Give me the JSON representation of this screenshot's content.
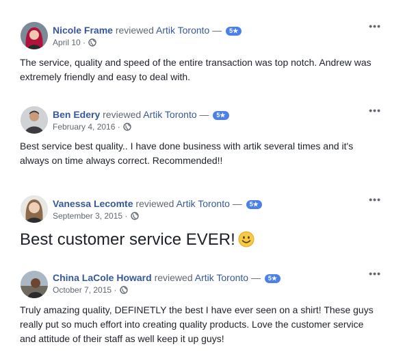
{
  "reviews": [
    {
      "author": "Nicole Frame",
      "verb": "reviewed",
      "page": "Artik Toronto",
      "dash": "—",
      "rating_badge": "5★",
      "date": "April 10",
      "separator": "·",
      "text": "The service, quality and speed of the entire transaction was top notch. Andrew was extremely friendly and easy to deal with.",
      "more": "•••"
    },
    {
      "author": "Ben Edery",
      "verb": "reviewed",
      "page": "Artik Toronto",
      "dash": "—",
      "rating_badge": "5★",
      "date": "February 4, 2016",
      "separator": "·",
      "text": "Best service best quality.. I have done business with artik several times and it's always on time always correct. Recommended!!",
      "more": "•••"
    },
    {
      "author": "Vanessa Lecomte",
      "verb": "reviewed",
      "page": "Artik Toronto",
      "dash": "—",
      "rating_badge": "5★",
      "date": "September 3, 2015",
      "separator": "·",
      "text": "Best customer service EVER!",
      "more": "•••"
    },
    {
      "author": "China LaCole Howard",
      "verb": "reviewed",
      "page": "Artik Toronto",
      "dash": "—",
      "rating_badge": "5★",
      "date": "October 7, 2015",
      "separator": "·",
      "text": "Truly amazing quality, DEFINETLY the best I have ever seen on a shirt! These guys really put so much effort into creating quality products. Love the customer service and attitude of their staff as well keep it up guys!",
      "more": "•••"
    }
  ],
  "icons": {
    "privacy": "globe-icon",
    "emoji": "smiley-face-icon",
    "options": "more-options-icon"
  },
  "colors": {
    "link": "#365899",
    "badge": "#4a80e8",
    "meta": "#616770",
    "text": "#1d2129"
  }
}
